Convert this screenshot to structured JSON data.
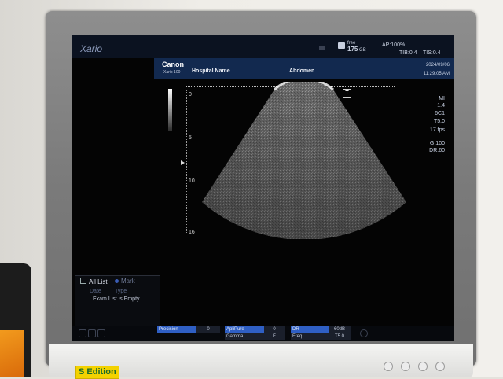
{
  "screen": {
    "brand": "Xario",
    "storage": {
      "label": "free",
      "value": "175",
      "unit": "GB"
    },
    "ap": "AP:100%",
    "tib": "TIB:0.4",
    "tis": "TIS:0.4"
  },
  "info": {
    "maker": "Canon",
    "model": "Xario 100",
    "hospital": "Hospital Name",
    "exam": "Abdomen",
    "date": "2024/09/06",
    "time": "11:29:05 AM"
  },
  "depth_scale": {
    "labels": [
      "0",
      "5",
      "10",
      "16"
    ]
  },
  "params": {
    "mi": "MI",
    "mi_value": "1.4",
    "probe": "6C1",
    "t": "T5.0",
    "fps": "17 fps",
    "gain": "G:100",
    "dr": "DR:60"
  },
  "marker": "T",
  "exam_panel": {
    "all_list": "All List",
    "mark": "Mark",
    "col_date": "Date",
    "col_type": "Type",
    "empty_text": "Exam List is Empty"
  },
  "bottom_bar": {
    "precision_label": "Precision",
    "precision_value": "0",
    "apli_label": "ApliPure",
    "apli_value": "0",
    "gamma_label": "Gamma",
    "gamma_value": "E",
    "dr_label": "DR",
    "dr_value": "60dB",
    "freq_label": "Freq",
    "freq_value": "T5.0"
  },
  "monitor": {
    "edition_label": "S Edition"
  },
  "colors": {
    "accent": "#2f5fc4",
    "info_bar": "#12294f",
    "edition_badge": "#f3d200"
  }
}
